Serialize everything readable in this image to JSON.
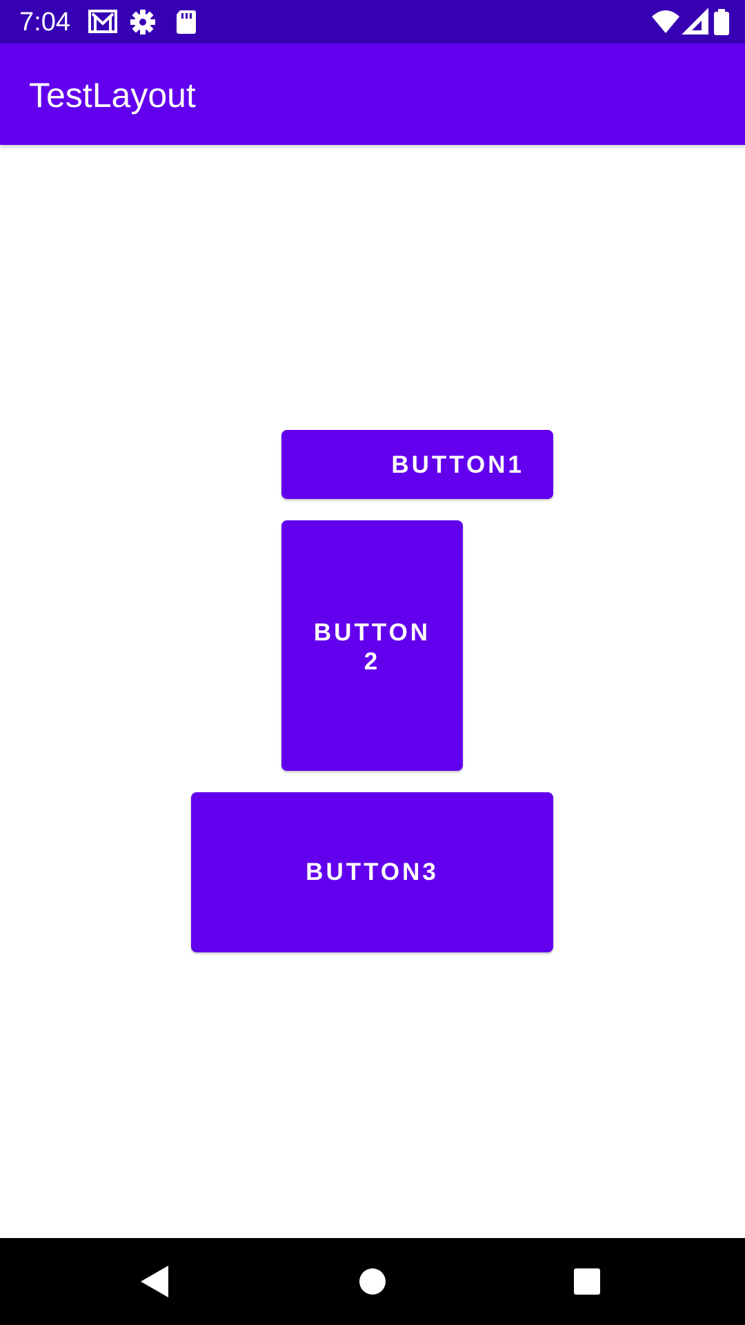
{
  "status_bar": {
    "time": "7:04",
    "icons": [
      "gmail-icon",
      "settings-gear-icon",
      "sd-card-icon",
      "wifi-icon",
      "signal-icon",
      "battery-icon"
    ]
  },
  "app_bar": {
    "title": "TestLayout"
  },
  "buttons": {
    "button1": "BUTTON1",
    "button2": "BUTTON 2",
    "button3": "BUTTON3"
  },
  "nav_bar": {
    "icons": [
      "back-icon",
      "home-icon",
      "recents-icon"
    ]
  },
  "colors": {
    "status_bar": "#3700B3",
    "primary": "#6200EE",
    "background": "#FFFFFF",
    "nav_bar": "#000000"
  }
}
